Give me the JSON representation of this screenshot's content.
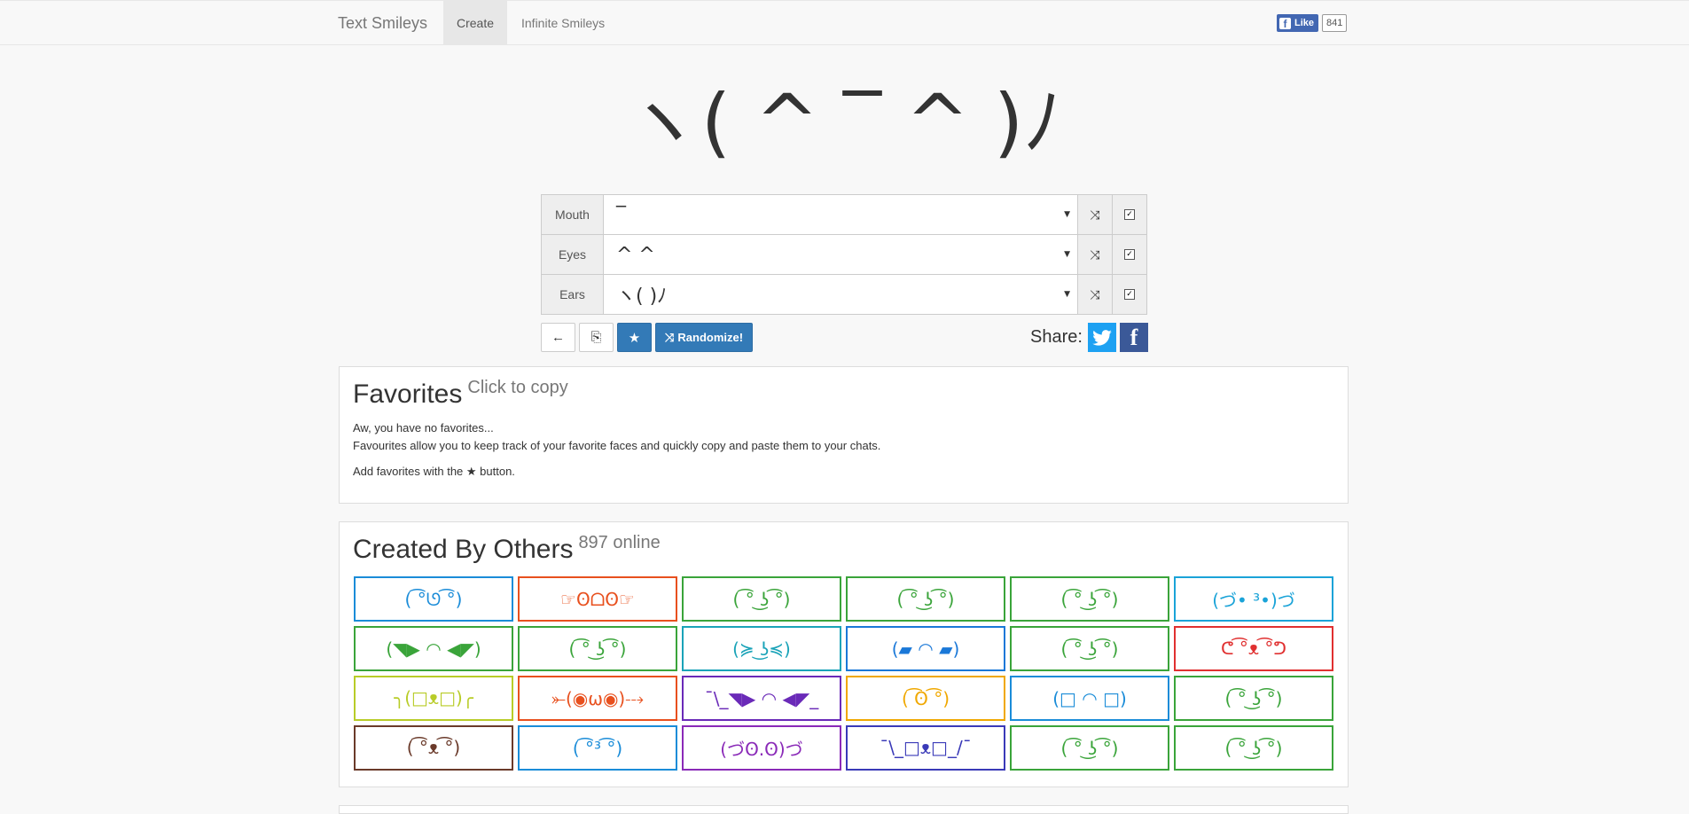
{
  "nav": {
    "brand": "Text Smileys",
    "create": "Create",
    "infinite": "Infinite Smileys",
    "fb_like": "Like",
    "fb_count": "841"
  },
  "face": "ヽ( ^ ‾ ^ )ﾉ",
  "controls": {
    "mouth_label": "Mouth",
    "mouth_value": "‾",
    "eyes_label": "Eyes",
    "eyes_value": "^ ^",
    "ears_label": "Ears",
    "ears_value": "ヽ( )ﾉ"
  },
  "toolbar": {
    "back_icon": "←",
    "copy_icon": "⎘",
    "star_icon": "★",
    "randomize_label": "Randomize!",
    "share_label": "Share:"
  },
  "favorites": {
    "title": "Favorites",
    "subtitle": "Click to copy",
    "line1": "Aw, you have no favorites...",
    "line2": "Favourites allow you to keep track of your favorite faces and quickly copy and paste them to your chats.",
    "line3": "Add favorites with the ★ button."
  },
  "others": {
    "title": "Created By Others",
    "subtitle": "897 online",
    "cells": [
      {
        "text": "( ͡°ᘎ ͡°)",
        "color": "#1a8cd8"
      },
      {
        "text": "☞ʘᗝʘ☞",
        "color": "#e8501e"
      },
      {
        "text": "( ͡° ͜ʖ ͡°)",
        "color": "#3aa43a"
      },
      {
        "text": "( ͡° ͜ʖ ͡°)",
        "color": "#3aa43a"
      },
      {
        "text": "( ͡° ͜ʖ ͡°)",
        "color": "#3aa43a"
      },
      {
        "text": "(づ• ³•)づ",
        "color": "#1aa3d8"
      },
      {
        "text": "(◥▶ ◠ ◀◤)",
        "color": "#3aa43a"
      },
      {
        "text": "( ͡° ͜ʖ ͡°)",
        "color": "#3aa43a"
      },
      {
        "text": "(≽ ͜ʖ≼)",
        "color": "#1aa3b8"
      },
      {
        "text": "(▰ ◠ ▰)",
        "color": "#1a78d8"
      },
      {
        "text": "( ͡° ͜ʖ ͡°)",
        "color": "#3aa43a"
      },
      {
        "text": "ᕦ ͡°ᴥ ͡°ᕤ",
        "color": "#e03030"
      },
      {
        "text": "╮(□ᴥ□)╭",
        "color": "#b8cc28"
      },
      {
        "text": "⤜(◉ω◉)⤏",
        "color": "#e8501e"
      },
      {
        "text": "¯\\_◥▶ ◠ ◀◤_",
        "color": "#6a2ab8"
      },
      {
        "text": "( ͡ʘ ͡°)",
        "color": "#f0a800"
      },
      {
        "text": "(□ ◠ □)",
        "color": "#1a8cd8"
      },
      {
        "text": "( ͡° ͜ʖ ͡°)",
        "color": "#3aa43a"
      },
      {
        "text": "( ͡°ᴥ ͡°)",
        "color": "#6a3a2a"
      },
      {
        "text": "( ͡°³ ͡°)",
        "color": "#1a8cd8"
      },
      {
        "text": "(づʘ.ʘ)づ",
        "color": "#8a2ab8"
      },
      {
        "text": "¯\\_□ᴥ□_/¯",
        "color": "#3a3ab8"
      },
      {
        "text": "( ͡° ͜ʖ ͡°)",
        "color": "#3aa43a"
      },
      {
        "text": "( ͡° ͜ʖ ͡°)",
        "color": "#3aa43a"
      }
    ]
  }
}
